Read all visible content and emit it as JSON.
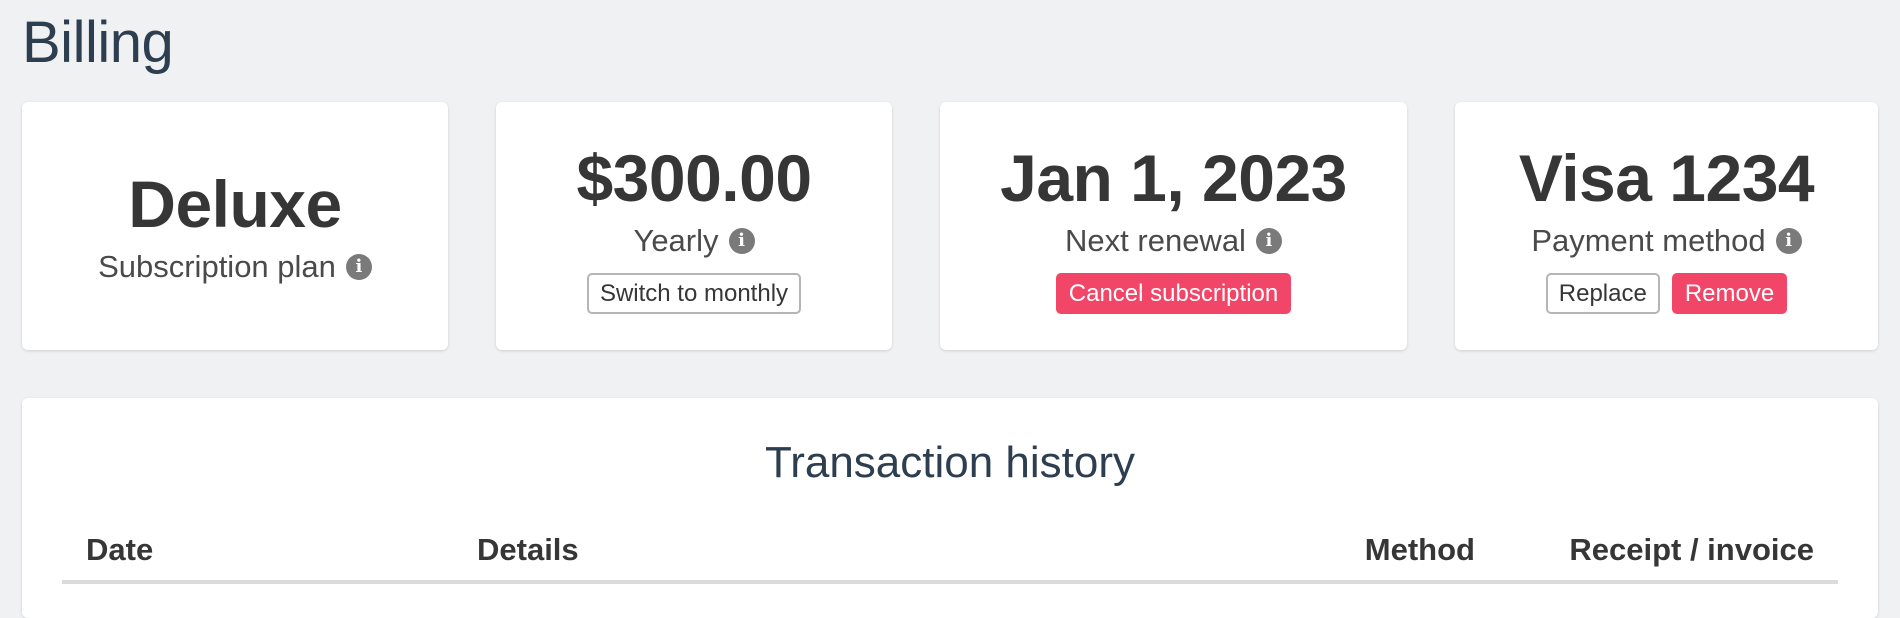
{
  "page": {
    "title": "Billing"
  },
  "cards": {
    "plan": {
      "value": "Deluxe",
      "label": "Subscription plan",
      "info_icon": "info-circle-icon"
    },
    "price": {
      "value": "$300.00",
      "label": "Yearly",
      "info_icon": "info-circle-icon",
      "action_label": "Switch to monthly"
    },
    "renewal": {
      "value": "Jan 1, 2023",
      "label": "Next renewal",
      "info_icon": "info-circle-icon",
      "action_label": "Cancel subscription"
    },
    "payment": {
      "value": "Visa 1234",
      "label": "Payment method",
      "info_icon": "info-circle-icon",
      "replace_label": "Replace",
      "remove_label": "Remove"
    }
  },
  "history": {
    "title": "Transaction history",
    "columns": [
      "Date",
      "Details",
      "Method",
      "Receipt / invoice"
    ]
  },
  "colors": {
    "background": "#f0f1f3",
    "card": "#ffffff",
    "heading": "#2c3e50",
    "danger": "#f14668",
    "info_icon": "#7a7a7a"
  }
}
